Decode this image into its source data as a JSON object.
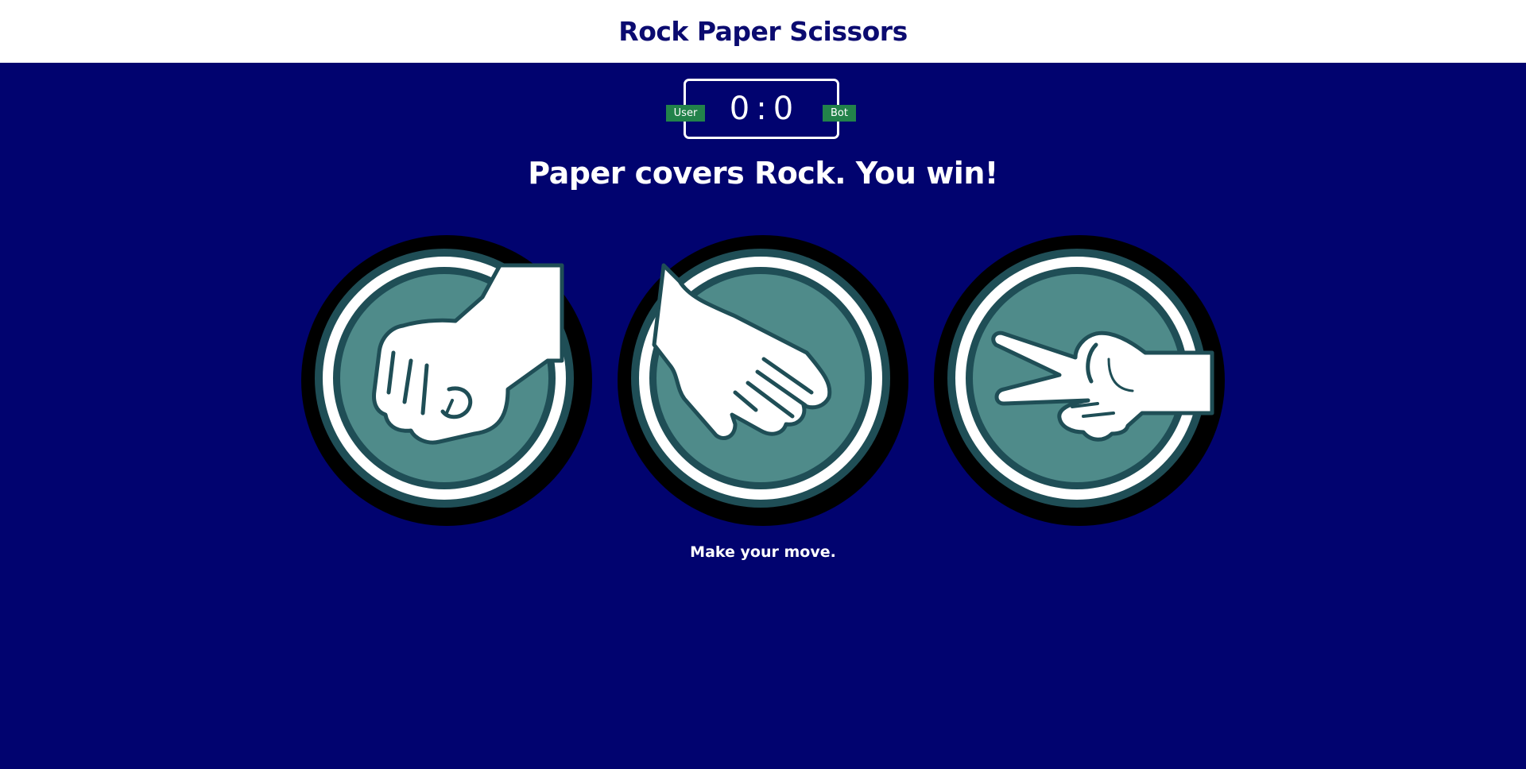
{
  "header": {
    "title": "Rock Paper Scissors"
  },
  "scoreboard": {
    "user_label": "User",
    "bot_label": "Bot",
    "user_score": "0",
    "separator": ":",
    "bot_score": "0"
  },
  "result_message": "Paper covers Rock. You win!",
  "choices": [
    {
      "name": "rock",
      "icon": "rock-fist-icon"
    },
    {
      "name": "paper",
      "icon": "paper-hand-icon"
    },
    {
      "name": "scissors",
      "icon": "scissors-hand-icon"
    }
  ],
  "prompt": "Make your move.",
  "colors": {
    "background": "#01036f",
    "header_bg": "#ffffff",
    "title": "#0b0b70",
    "badge": "#22824a",
    "circle_fill": "#4f8b8a",
    "circle_dark": "#1f4e56"
  }
}
